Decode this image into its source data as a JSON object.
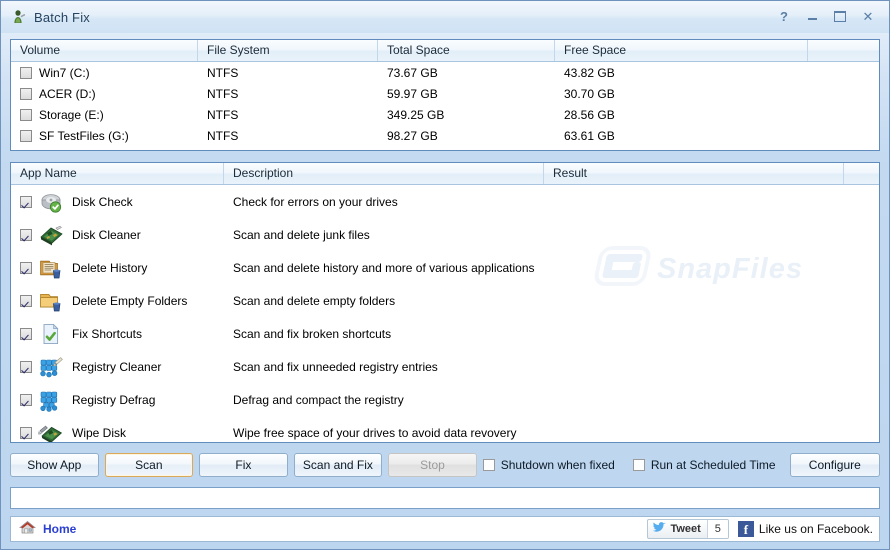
{
  "window": {
    "title": "Batch Fix",
    "icon": "app-icon",
    "controls": {
      "help": "?",
      "minimize": "minimize",
      "maximize": "maximize",
      "close": "✕"
    }
  },
  "volumes_table": {
    "columns": [
      "Volume",
      "File System",
      "Total Space",
      "Free Space",
      ""
    ],
    "rows": [
      {
        "checked": false,
        "volume": "Win7 (C:)",
        "file_system": "NTFS",
        "total_space": "73.67 GB",
        "free_space": "43.82 GB"
      },
      {
        "checked": false,
        "volume": "ACER (D:)",
        "file_system": "NTFS",
        "total_space": "59.97 GB",
        "free_space": "30.70 GB"
      },
      {
        "checked": false,
        "volume": "Storage (E:)",
        "file_system": "NTFS",
        "total_space": "349.25 GB",
        "free_space": "28.56 GB"
      },
      {
        "checked": false,
        "volume": "SF TestFiles (G:)",
        "file_system": "NTFS",
        "total_space": "98.27 GB",
        "free_space": "63.61 GB"
      }
    ]
  },
  "apps_table": {
    "columns": [
      "App Name",
      "Description",
      "Result",
      ""
    ],
    "rows": [
      {
        "checked": true,
        "icon": "hard-drive-check-icon",
        "name": "Disk Check",
        "description": "Check for errors on your drives",
        "result": ""
      },
      {
        "checked": true,
        "icon": "circuit-board-icon",
        "name": "Disk Cleaner",
        "description": "Scan and delete junk files",
        "result": ""
      },
      {
        "checked": true,
        "icon": "history-folder-icon",
        "name": "Delete History",
        "description": "Scan and delete history and more of various applications",
        "result": ""
      },
      {
        "checked": true,
        "icon": "empty-folder-icon",
        "name": "Delete Empty Folders",
        "description": "Scan and delete empty folders",
        "result": ""
      },
      {
        "checked": true,
        "icon": "document-check-icon",
        "name": "Fix Shortcuts",
        "description": "Scan and fix broken shortcuts",
        "result": ""
      },
      {
        "checked": true,
        "icon": "registry-blocks-brush-icon",
        "name": "Registry Cleaner",
        "description": "Scan and fix unneeded registry entries",
        "result": ""
      },
      {
        "checked": true,
        "icon": "registry-blocks-icon",
        "name": "Registry Defrag",
        "description": "Defrag and compact the registry",
        "result": ""
      },
      {
        "checked": true,
        "icon": "wipe-disk-icon",
        "name": "Wipe Disk",
        "description": "Wipe free space of your drives to avoid data revovery",
        "result": ""
      }
    ]
  },
  "watermark": {
    "text": "SnapFiles"
  },
  "toolbar": {
    "show_app": "Show App",
    "scan": "Scan",
    "fix": "Fix",
    "scan_and_fix": "Scan and Fix",
    "stop": "Stop",
    "shutdown_when_fixed": "Shutdown when fixed",
    "shutdown_checked": false,
    "run_at_scheduled_time": "Run at Scheduled Time",
    "scheduled_checked": false,
    "configure": "Configure"
  },
  "status": {
    "text": ""
  },
  "footer": {
    "home": "Home",
    "tweet": "Tweet",
    "tweet_count": "5",
    "facebook": "Like us on Facebook.",
    "facebook_glyph": "f"
  },
  "colors": {
    "window_chrome": "#bdd6ef",
    "panel_border": "#5f8bbd",
    "link_blue": "#2b3fd0",
    "facebook_blue": "#3b5998",
    "focus_border": "#dba95c"
  }
}
